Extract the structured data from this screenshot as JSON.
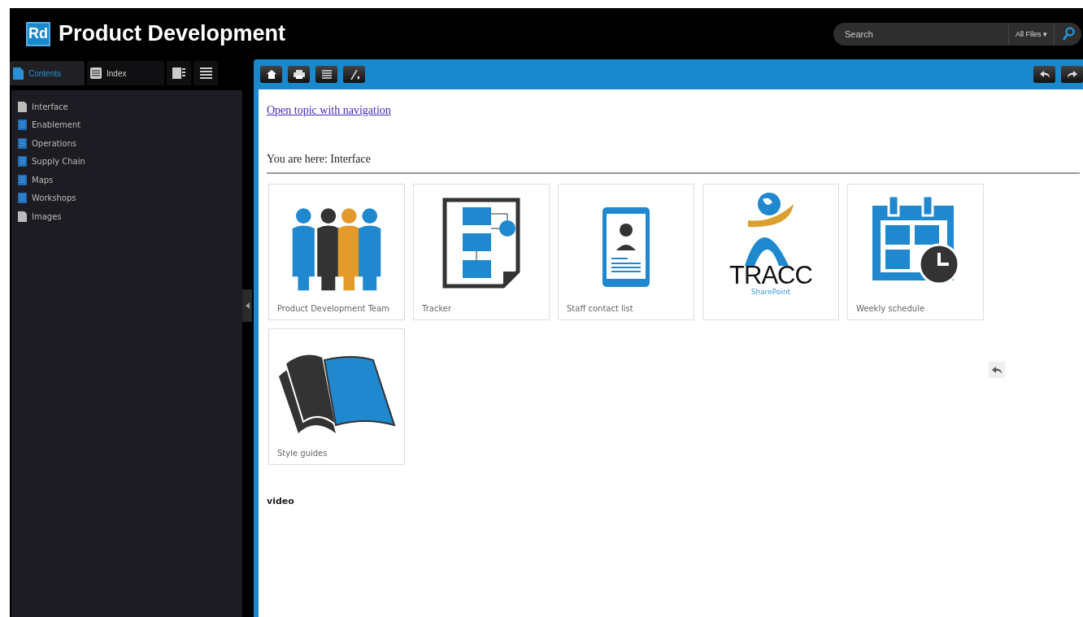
{
  "header": {
    "logo": "Rd",
    "title": "Product Development",
    "search": {
      "placeholder": "Search",
      "scope": "All Files ▾"
    }
  },
  "sidebar": {
    "tabs": [
      {
        "label": "Contents",
        "kind": "contents",
        "selected": true
      },
      {
        "label": "Index",
        "kind": "index",
        "selected": false
      }
    ],
    "items": [
      {
        "label": "Interface",
        "kind": "page"
      },
      {
        "label": "Enablement",
        "kind": "book"
      },
      {
        "label": "Operations",
        "kind": "book"
      },
      {
        "label": "Supply Chain",
        "kind": "book"
      },
      {
        "label": "Maps",
        "kind": "book"
      },
      {
        "label": "Workshops",
        "kind": "book"
      },
      {
        "label": "Images",
        "kind": "page"
      }
    ]
  },
  "content": {
    "link": "Open topic with navigation",
    "breadcrumb": "You are here: Interface",
    "tiles": [
      {
        "kind": "team",
        "caption": "Product Development Team"
      },
      {
        "kind": "tracker",
        "caption": "Tracker"
      },
      {
        "kind": "contact",
        "caption": "Staff contact list"
      },
      {
        "kind": "tracc",
        "logo": "TRACC",
        "logo_sub": "SharePoint"
      },
      {
        "kind": "schedule",
        "caption": "Weekly schedule"
      },
      {
        "kind": "guide",
        "caption": "Style guides"
      }
    ],
    "footer": "video"
  }
}
